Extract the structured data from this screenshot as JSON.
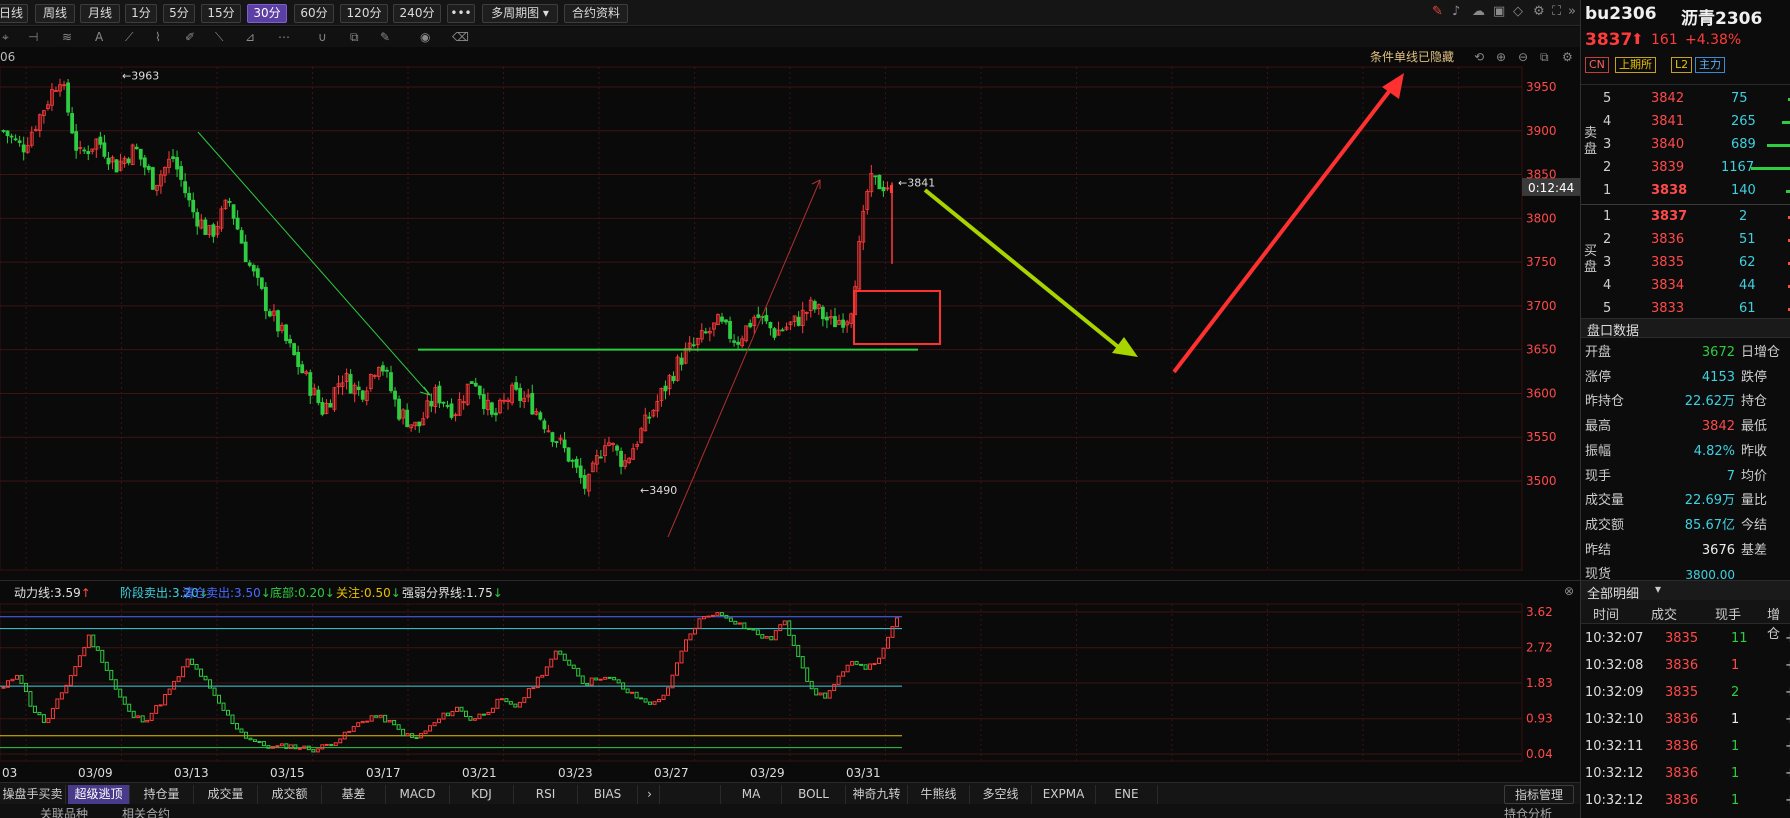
{
  "toolbar": {
    "periods": [
      "日线",
      "周线",
      "月线",
      "1分",
      "5分",
      "15分",
      "30分",
      "60分",
      "120分",
      "240分"
    ],
    "active_period": "30分",
    "more_label": "•••",
    "multi_label": "多周期图",
    "contract_label": "合约资料"
  },
  "chart_header": {
    "symbol_fragment": "06",
    "hidden_notice": "条件单线已隐藏"
  },
  "symbol": {
    "code": "bu2306",
    "name": "沥青2306",
    "price": "3837",
    "change": "161",
    "change_pct": "+4.38%",
    "badges": [
      "CN",
      "上期所",
      "L2",
      "主力"
    ]
  },
  "chart_data": {
    "type": "candlestick",
    "y_ticks": [
      3950,
      3900,
      3850,
      3800,
      3750,
      3700,
      3650,
      3600,
      3550,
      3500
    ],
    "x_ticks": [
      "03",
      "03/09",
      "03/13",
      "03/15",
      "03/17",
      "03/21",
      "03/23",
      "03/27",
      "03/29",
      "03/31"
    ],
    "high_label": "3963",
    "low_label": "3490",
    "last_label": "3841",
    "countdown": "0:12:44",
    "support_price": 3650,
    "colors": {
      "up": "#ff3b3b",
      "down": "#2ecc40",
      "support": "#2ecc40",
      "arrow_red": "#ff3030",
      "arrow_yellow": "#a8d400"
    },
    "path": [
      3900,
      3880,
      3920,
      3963,
      3870,
      3890,
      3860,
      3880,
      3840,
      3870,
      3810,
      3780,
      3820,
      3750,
      3700,
      3660,
      3620,
      3580,
      3620,
      3600,
      3640,
      3580,
      3560,
      3600,
      3580,
      3620,
      3570,
      3600,
      3590,
      3560,
      3530,
      3490,
      3550,
      3520,
      3560,
      3600,
      3640,
      3660,
      3680,
      3660,
      3690,
      3670,
      3680,
      3700,
      3680,
      3690,
      3841,
      3838
    ]
  },
  "indicator": {
    "legend": [
      {
        "label": "动力线:3.59",
        "arrow": "↑",
        "color": "#e0e0e0"
      },
      {
        "label": "阶段卖出:3.20",
        "arrow": "↓",
        "color": "#3fd0e0"
      },
      {
        "label": "清仓卖出:3.50",
        "arrow": "↓",
        "color": "#4a6aff"
      },
      {
        "label": "底部:0.20",
        "arrow": "↓",
        "color": "#2ecc40"
      },
      {
        "label": "关注:0.50",
        "arrow": "↓",
        "color": "#e8c000"
      },
      {
        "label": "强弱分界线:1.75",
        "arrow": "↓",
        "color": "#e0e0e0"
      }
    ],
    "y_ticks": [
      "3.62",
      "2.72",
      "1.83",
      "0.93",
      "0.04"
    ],
    "values": [
      1.7,
      2.1,
      1.2,
      0.8,
      1.5,
      2.2,
      3.0,
      2.4,
      1.6,
      1.0,
      0.9,
      1.3,
      1.8,
      2.4,
      2.0,
      1.4,
      0.9,
      0.5,
      0.3,
      0.2,
      0.25,
      0.2,
      0.15,
      0.3,
      0.5,
      0.8,
      1.0,
      0.9,
      0.6,
      0.4,
      0.7,
      1.0,
      1.2,
      0.9,
      1.1,
      1.4,
      1.2,
      1.6,
      2.1,
      2.6,
      2.3,
      1.8,
      2.0,
      1.9,
      1.6,
      1.4,
      1.3,
      1.8,
      2.8,
      3.4,
      3.6,
      3.5,
      3.3,
      3.1,
      2.9,
      3.4,
      2.6,
      1.6,
      1.5,
      2.0,
      2.4,
      2.2,
      2.6,
      3.5
    ]
  },
  "tabs": {
    "left": [
      "操盘手买卖",
      "超级逃顶",
      "持仓量",
      "成交量",
      "成交额",
      "基差",
      "MACD",
      "KDJ",
      "RSI",
      "BIAS"
    ],
    "active_left": "超级逃顶",
    "right": [
      "MA",
      "BOLL",
      "神奇九转",
      "牛熊线",
      "多空线",
      "EXPMA",
      "ENE"
    ],
    "manage": "指标管理"
  },
  "bottom": {
    "items": [
      "关联品种",
      "相关合约"
    ],
    "right_label": "持仓分析"
  },
  "orderbook": {
    "sell_label": "卖盘",
    "buy_label": "买盘",
    "asks": [
      {
        "lv": "5",
        "price": "3842",
        "vol": "75"
      },
      {
        "lv": "4",
        "price": "3841",
        "vol": "265"
      },
      {
        "lv": "3",
        "price": "3840",
        "vol": "689"
      },
      {
        "lv": "2",
        "price": "3839",
        "vol": "1167"
      },
      {
        "lv": "1",
        "price": "3838",
        "vol": "140"
      }
    ],
    "bids": [
      {
        "lv": "1",
        "price": "3837",
        "vol": "2"
      },
      {
        "lv": "2",
        "price": "3836",
        "vol": "51"
      },
      {
        "lv": "3",
        "price": "3835",
        "vol": "62"
      },
      {
        "lv": "4",
        "price": "3834",
        "vol": "44"
      },
      {
        "lv": "5",
        "price": "3833",
        "vol": "61"
      }
    ]
  },
  "market_data": {
    "title": "盘口数据",
    "rows": [
      {
        "label": "开盘",
        "value": "3672",
        "color": "green",
        "label2": "日增仓"
      },
      {
        "label": "涨停",
        "value": "4153",
        "color": "cyan",
        "label2": "跌停"
      },
      {
        "label": "昨持仓",
        "value": "22.62万",
        "color": "cyan",
        "label2": "持仓"
      },
      {
        "label": "最高",
        "value": "3842",
        "color": "red",
        "label2": "最低"
      },
      {
        "label": "振幅",
        "value": "4.82%",
        "color": "cyan",
        "label2": "昨收"
      },
      {
        "label": "现手",
        "value": "7",
        "color": "cyan",
        "label2": "均价"
      },
      {
        "label": "成交量",
        "value": "22.69万",
        "color": "cyan",
        "label2": "量比"
      },
      {
        "label": "成交额",
        "value": "85.67亿",
        "color": "cyan",
        "label2": "今结"
      },
      {
        "label": "昨结",
        "value": "3676",
        "color": "white",
        "label2": "基差"
      },
      {
        "label": "现货",
        "value": "3800.00",
        "color": "cyan",
        "label2": ""
      }
    ]
  },
  "trades": {
    "title": "全部明细",
    "headers": [
      "时间",
      "成交",
      "现手",
      "增仓"
    ],
    "rows": [
      {
        "time": "10:32:07",
        "price": "3835",
        "hand": "11",
        "color": "green"
      },
      {
        "time": "10:32:08",
        "price": "3836",
        "hand": "1",
        "color": "red"
      },
      {
        "time": "10:32:09",
        "price": "3835",
        "hand": "2",
        "color": "green"
      },
      {
        "time": "10:32:10",
        "price": "3836",
        "hand": "1",
        "color": "white"
      },
      {
        "time": "10:32:11",
        "price": "3836",
        "hand": "1",
        "color": "green"
      },
      {
        "time": "10:32:12",
        "price": "3836",
        "hand": "1",
        "color": "green"
      },
      {
        "time": "10:32:12",
        "price": "3836",
        "hand": "1",
        "color": "green"
      }
    ]
  }
}
